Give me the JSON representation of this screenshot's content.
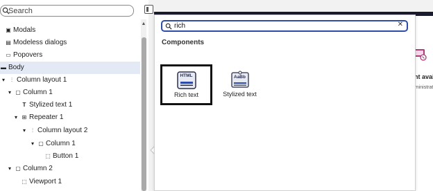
{
  "tree": {
    "search_placeholder": "Search",
    "items": [
      {
        "label": "Modals",
        "glyph": "▣",
        "selected": false
      },
      {
        "label": "Modeless dialogs",
        "glyph": "▤",
        "selected": false
      },
      {
        "label": "Popovers",
        "glyph": "▭",
        "selected": false
      },
      {
        "label": "Body",
        "glyph": "▬",
        "selected": true
      },
      {
        "label": "Column layout 1",
        "glyph": "▾ ⫶",
        "selected": false
      },
      {
        "label": "Column 1",
        "glyph": "▾ ▢",
        "selected": false
      },
      {
        "label": "Stylized text 1",
        "glyph": "T",
        "selected": false
      },
      {
        "label": "Repeater 1",
        "glyph": "▾ ⊞",
        "selected": false
      },
      {
        "label": "Column layout 2",
        "glyph": "▾ ⫶",
        "selected": false
      },
      {
        "label": "Column 1",
        "glyph": "▾ ▢",
        "selected": false
      },
      {
        "label": "Button 1",
        "glyph": "⬚",
        "selected": false
      },
      {
        "label": "Column 2",
        "glyph": "▾ ▢",
        "selected": false
      },
      {
        "label": "Viewport 1",
        "glyph": "⬚",
        "selected": false
      }
    ]
  },
  "picker": {
    "search_value": "rich",
    "clear_glyph": "✕",
    "section_title": "Components",
    "components": [
      {
        "label": "Rich text",
        "thumb_text": "HTML",
        "selected": true
      },
      {
        "label": "Stylized text",
        "thumb_text": "AaBb",
        "selected": false
      }
    ]
  },
  "preview": {
    "partial_heading": "ent avai",
    "partial_subtext": "dministrat"
  },
  "colors": {
    "accent": "#2e4ba8",
    "selection_bg": "#e4eaf5",
    "device_bar": "#1b1b2e",
    "preview_icon": "#b03a7a"
  }
}
